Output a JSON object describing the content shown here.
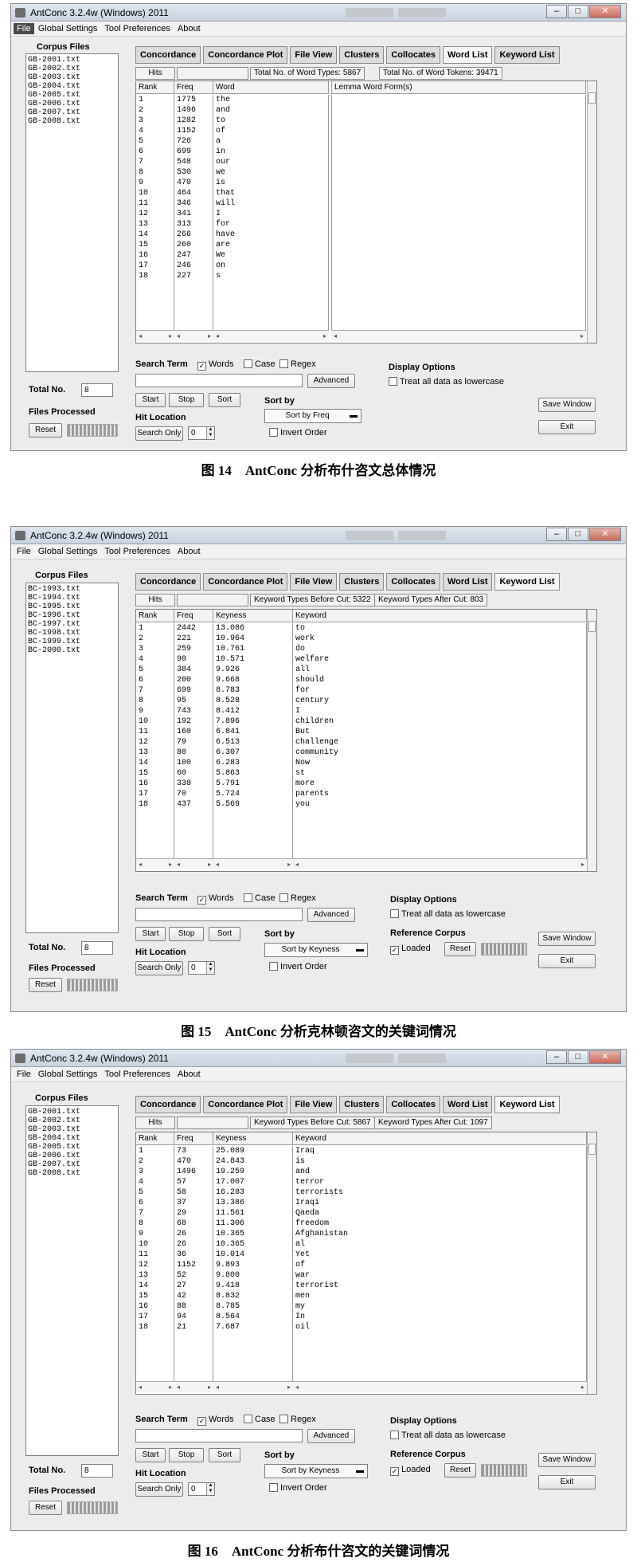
{
  "title": "AntConc 3.2.4w (Windows) 2011",
  "menu": [
    "File",
    "Global Settings",
    "Tool Preferences",
    "About"
  ],
  "tabs": [
    "Concordance",
    "Concordance Plot",
    "File View",
    "Clusters",
    "Collocates",
    "Word List",
    "Keyword List"
  ],
  "labels": {
    "corpus_files": "Corpus Files",
    "total_no": "Total No.",
    "files_processed": "Files Processed",
    "reset": "Reset",
    "hits": "Hits",
    "search_term": "Search Term",
    "words": "Words",
    "case": "Case",
    "regex": "Regex",
    "advanced": "Advanced",
    "start": "Start",
    "stop": "Stop",
    "sort": "Sort",
    "sort_by": "Sort by",
    "invert_order": "Invert Order",
    "hit_location": "Hit Location",
    "search_only": "Search Only",
    "display_options": "Display Options",
    "lowercase": "Treat all data as lowercase",
    "reference_corpus": "Reference Corpus",
    "loaded": "Loaded",
    "save_window": "Save Window",
    "exit": "Exit",
    "col_rank": "Rank",
    "col_freq": "Freq",
    "col_word": "Word",
    "col_keyness": "Keyness",
    "col_keyword": "Keyword",
    "col_lemma": "Lemma Word Form(s)"
  },
  "panels": [
    {
      "selected_tab": "Word List",
      "files": [
        "GB-2001.txt",
        "GB-2002.txt",
        "GB-2003.txt",
        "GB-2004.txt",
        "GB-2005.txt",
        "GB-2006.txt",
        "GB-2007.txt",
        "GB-2008.txt"
      ],
      "total_no": "8",
      "stat1": "Total No. of Word Types: 5867",
      "stat2": "Total No. of Word Tokens: 39471",
      "sort_by": "Sort by Freq",
      "spin": "0",
      "caption": "图 14　AntConc 分析布什咨文总体情况",
      "rank": [
        "1",
        "2",
        "3",
        "4",
        "5",
        "6",
        "7",
        "8",
        "9",
        "10",
        "11",
        "12",
        "13",
        "14",
        "15",
        "16",
        "17",
        "18"
      ],
      "freq": [
        "1775",
        "1496",
        "1282",
        "1152",
        "726",
        "699",
        "548",
        "530",
        "470",
        "464",
        "346",
        "341",
        "313",
        "266",
        "260",
        "247",
        "246",
        "227"
      ],
      "word": [
        "the",
        "and",
        "to",
        "of",
        "a",
        "in",
        "our",
        "we",
        "is",
        "that",
        "will",
        "I",
        "for",
        "have",
        "are",
        "We",
        "on",
        "s"
      ]
    },
    {
      "selected_tab": "Keyword List",
      "files": [
        "BC-1993.txt",
        "BC-1994.txt",
        "BC-1995.txt",
        "BC-1996.txt",
        "BC-1997.txt",
        "BC-1998.txt",
        "BC-1999.txt",
        "BC-2000.txt"
      ],
      "total_no": "8",
      "stat1": "Keyword Types Before Cut: 5322",
      "stat2": "Keyword Types After Cut: 803",
      "sort_by": "Sort by Keyness",
      "spin": "0",
      "caption": "图 15　AntConc 分析克林顿咨文的关键词情况",
      "rank": [
        "1",
        "2",
        "3",
        "4",
        "5",
        "6",
        "7",
        "8",
        "9",
        "10",
        "11",
        "12",
        "13",
        "14",
        "15",
        "16",
        "17",
        "18"
      ],
      "freq": [
        "2442",
        "221",
        "259",
        "90",
        "384",
        "200",
        "699",
        "95",
        "743",
        "192",
        "160",
        "79",
        "80",
        "100",
        "60",
        "338",
        "70",
        "437"
      ],
      "keyness": [
        "13.086",
        "10.964",
        "10.761",
        "10.571",
        "9.926",
        "9.668",
        "8.783",
        "8.528",
        "8.412",
        "7.896",
        "6.841",
        "6.513",
        "6.307",
        "6.283",
        "5.863",
        "5.791",
        "5.724",
        "5.569"
      ],
      "keyword": [
        "to",
        "work",
        "do",
        "welfare",
        "all",
        "should",
        "for",
        "century",
        "I",
        "children",
        "But",
        "challenge",
        "community",
        "Now",
        "st",
        "more",
        "parents",
        "you"
      ]
    },
    {
      "selected_tab": "Keyword List",
      "files": [
        "GB-2001.txt",
        "GB-2002.txt",
        "GB-2003.txt",
        "GB-2004.txt",
        "GB-2005.txt",
        "GB-2006.txt",
        "GB-2007.txt",
        "GB-2008.txt"
      ],
      "total_no": "8",
      "stat1": "Keyword Types Before Cut: 5867",
      "stat2": "Keyword Types After Cut: 1097",
      "sort_by": "Sort by Keyness",
      "spin": "0",
      "caption": "图 16　AntConc 分析布什咨文的关键词情况",
      "rank": [
        "1",
        "2",
        "3",
        "4",
        "5",
        "6",
        "7",
        "8",
        "9",
        "10",
        "11",
        "12",
        "13",
        "14",
        "15",
        "16",
        "17",
        "18"
      ],
      "freq": [
        "73",
        "470",
        "1496",
        "57",
        "58",
        "37",
        "29",
        "68",
        "26",
        "26",
        "36",
        "1152",
        "52",
        "27",
        "42",
        "88",
        "94",
        "21"
      ],
      "keyness": [
        "25.089",
        "24.843",
        "19.259",
        "17.007",
        "16.283",
        "13.386",
        "11.561",
        "11.306",
        "10.365",
        "10.365",
        "10.014",
        "9.893",
        "9.800",
        "9.418",
        "8.832",
        "8.785",
        "8.564",
        "7.687"
      ],
      "keyword": [
        "Iraq",
        "is",
        "and",
        "terror",
        "terrorists",
        "Iraqi",
        "Qaeda",
        "freedom",
        "Afghanistan",
        "al",
        "Yet",
        "of",
        "war",
        "terrorist",
        "men",
        "my",
        "In",
        "oil"
      ]
    }
  ]
}
